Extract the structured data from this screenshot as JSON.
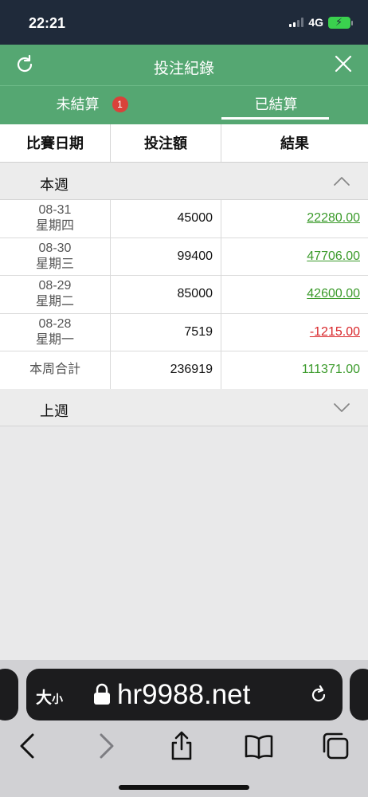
{
  "status_bar": {
    "time": "22:21",
    "network": "4G"
  },
  "header": {
    "title": "投注紀錄"
  },
  "tabs": [
    {
      "label": "未結算",
      "badge": "1"
    },
    {
      "label": "已結算"
    }
  ],
  "table_header": {
    "date": "比賽日期",
    "amount": "投注額",
    "result": "結果"
  },
  "sections": {
    "this_week": "本週",
    "last_week": "上週"
  },
  "rows": [
    {
      "date": "08-31",
      "weekday": "星期四",
      "amount": "45000",
      "result": "22280.00",
      "sign": "pos"
    },
    {
      "date": "08-30",
      "weekday": "星期三",
      "amount": "99400",
      "result": "47706.00",
      "sign": "pos"
    },
    {
      "date": "08-29",
      "weekday": "星期二",
      "amount": "85000",
      "result": "42600.00",
      "sign": "pos"
    },
    {
      "date": "08-28",
      "weekday": "星期一",
      "amount": "7519",
      "result": "-1215.00",
      "sign": "neg"
    }
  ],
  "total": {
    "label": "本周合計",
    "amount": "236919",
    "result": "111371.00"
  },
  "browser": {
    "text_size": "大",
    "text_size_small": "小",
    "url": "hr9988.net"
  },
  "colors": {
    "brand_green": "#55a772",
    "positive": "#3a9a2a",
    "negative": "#d9262a",
    "badge": "#d9423a"
  },
  "icons": [
    "refresh-icon",
    "close-icon",
    "chevron-up-icon",
    "chevron-down-icon",
    "lock-icon",
    "reload-icon",
    "back-icon",
    "forward-icon",
    "share-icon",
    "bookmarks-icon",
    "tabs-icon"
  ]
}
